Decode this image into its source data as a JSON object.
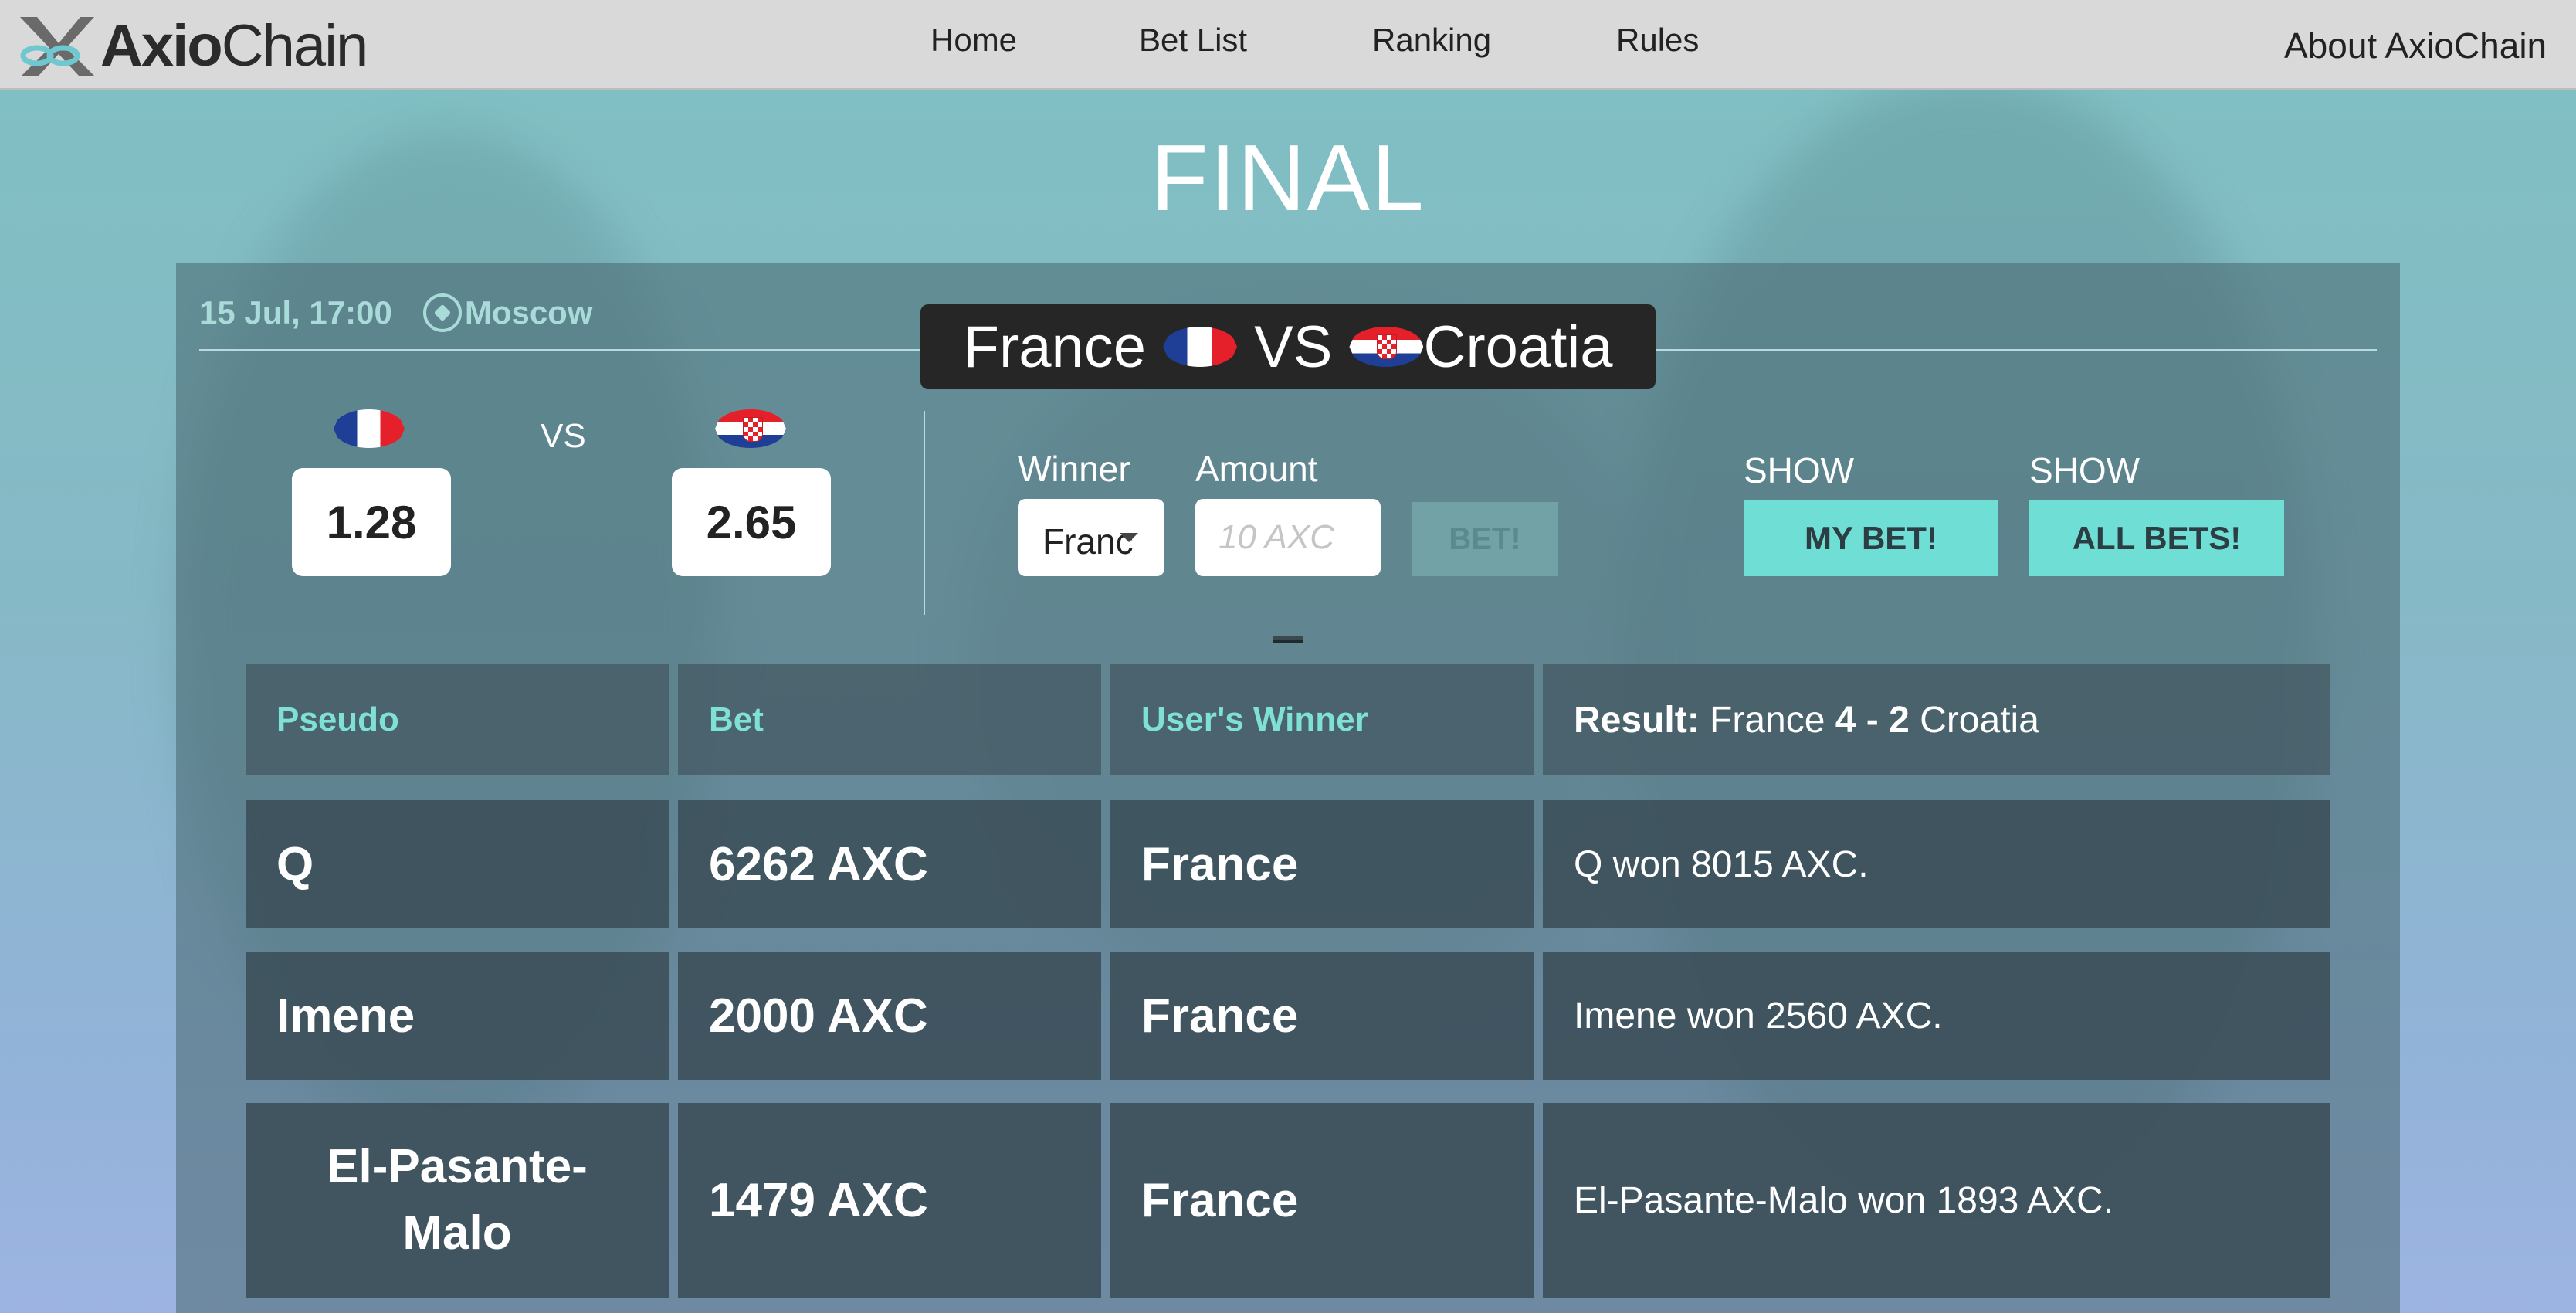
{
  "nav": {
    "brand": {
      "bold": "Axio",
      "light": "Chain"
    },
    "links": [
      "Home",
      "Bet List",
      "Ranking",
      "Rules"
    ],
    "about": "About AxioChain"
  },
  "title": "FINAL",
  "match": {
    "datetime": "15 Jul, 17:00",
    "city": "Moscow",
    "team1": "France",
    "team2": "Croatia",
    "vs_label": "VS",
    "odds_vs": "VS",
    "odds1": "1.28",
    "odds2": "2.65"
  },
  "form": {
    "winner_label": "Winner",
    "winner_value": "Franc",
    "amount_label": "Amount",
    "amount_placeholder": "10 AXC",
    "bet_button": "BET!",
    "show_label_1": "SHOW",
    "show_label_2": "SHOW",
    "my_bet_button": "MY BET!",
    "all_bets_button": "ALL BETS!"
  },
  "table": {
    "headers": [
      "Pseudo",
      "Bet",
      "User's Winner"
    ],
    "result": {
      "label": "Result:",
      "team1": "France",
      "score": "4 - 2",
      "team2": "Croatia"
    },
    "rows": [
      {
        "pseudo": "Q",
        "bet": "6262 AXC",
        "winner": "France",
        "message": "Q won 8015 AXC."
      },
      {
        "pseudo": "Imene",
        "bet": "2000 AXC",
        "winner": "France",
        "message": "Imene won 2560 AXC."
      },
      {
        "pseudo": "El-Pasante-Malo",
        "bet": "1479 AXC",
        "winner": "France",
        "message": "El-Pasante-Malo won 1893 AXC."
      }
    ]
  },
  "colors": {
    "accent": "#6fded4",
    "header_text": "#7fe0d6",
    "navbar": "#d9d9d9",
    "banner": "#262626"
  }
}
